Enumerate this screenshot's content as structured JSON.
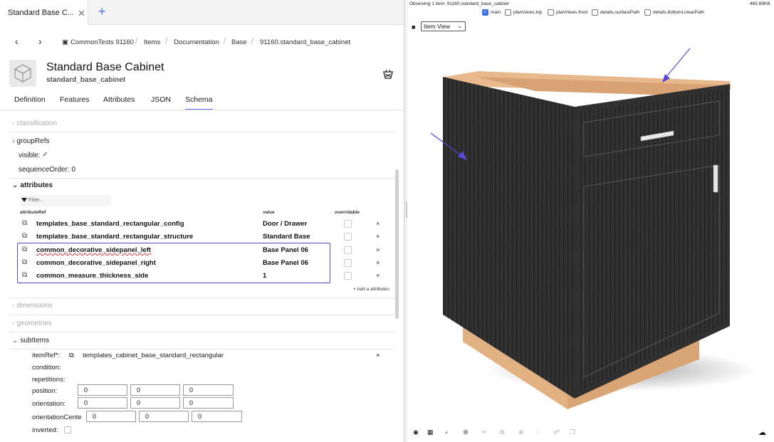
{
  "tabs": {
    "active_tab": "Standard Base C...",
    "close": "✕",
    "add": "+"
  },
  "breadcrumb": {
    "back": "‹",
    "forward": "›",
    "items": [
      "CommonTests 91160",
      "Items",
      "Documentation",
      "Base",
      "91160.standard_base_cabinet"
    ],
    "sep": "/"
  },
  "header": {
    "title": "Standard Base Cabinet",
    "subtitle": "standard_base_cabinet"
  },
  "nav_tabs": [
    "Definition",
    "Features",
    "Attributes",
    "JSON",
    "Schema"
  ],
  "schema": {
    "classification": "classification",
    "groupRefs": "groupRefs",
    "visible_label": "visible:",
    "visible_check": "✓",
    "sequenceOrder_label": "sequenceOrder:",
    "sequenceOrder_value": "0",
    "attributes_label": "attributes",
    "filter_placeholder": "Filter...",
    "col_ref": "attributeRef",
    "col_value": "value",
    "col_overridable": "overridable",
    "rows": [
      {
        "ref": "templates_base_standard_rectangular_config",
        "value": "Door / Drawer"
      },
      {
        "ref": "templates_base_standard_rectangular_structure",
        "value": "Standard Base"
      },
      {
        "ref": "common_decorative_sidepanel_left",
        "value": "Base Panel 06"
      },
      {
        "ref": "common_decorative_sidepanel_right",
        "value": "Base Panel 06"
      },
      {
        "ref": "common_measure_thickness_side",
        "value": "1"
      }
    ],
    "remove": "×",
    "ext_icon": "⧉",
    "add_attributes": "+ Add a attributes",
    "dimensions": "dimensions",
    "geometries": "geometries",
    "subItems": "subItems",
    "itemRef_label": "itemRef*:",
    "itemRef_value": "templates_cabinet_base_standard_rectangular",
    "condition": "condition:",
    "repetitions": "repetitions:",
    "position": "position:",
    "position_values": [
      "0",
      "0",
      "0"
    ],
    "orientation": "orientation:",
    "orientation_values": [
      "0",
      "0",
      "0"
    ],
    "orientationCenter": "orientationCente",
    "orientationCenter_values": [
      "0",
      "0",
      "0"
    ],
    "inverted": "inverted:"
  },
  "viewer": {
    "observing": "Observing 1 item: 91160.standard_base_cabinet",
    "size": "465.89KB",
    "views": [
      {
        "label": "main",
        "checked": true
      },
      {
        "label": "planViews.top",
        "checked": false
      },
      {
        "label": "planViews.front",
        "checked": false
      },
      {
        "label": "details.surfacePath",
        "checked": false
      },
      {
        "label": "details.bottomLinearPath",
        "checked": false
      }
    ],
    "view_select": "Item View",
    "select_arrow": "⌄"
  },
  "toolbar_icons": [
    "palette-icon",
    "grid-icon",
    "compass-icon",
    "cube-icon",
    "brush-icon",
    "crop-icon",
    "target-icon",
    "dots-grid-icon",
    "hierarchy-icon",
    "copy-icon"
  ],
  "colors": {
    "accent": "#5b7be0",
    "highlight": "#5b43c8",
    "cabinet": "#2b2b2b",
    "wood": "#e7b98c"
  }
}
